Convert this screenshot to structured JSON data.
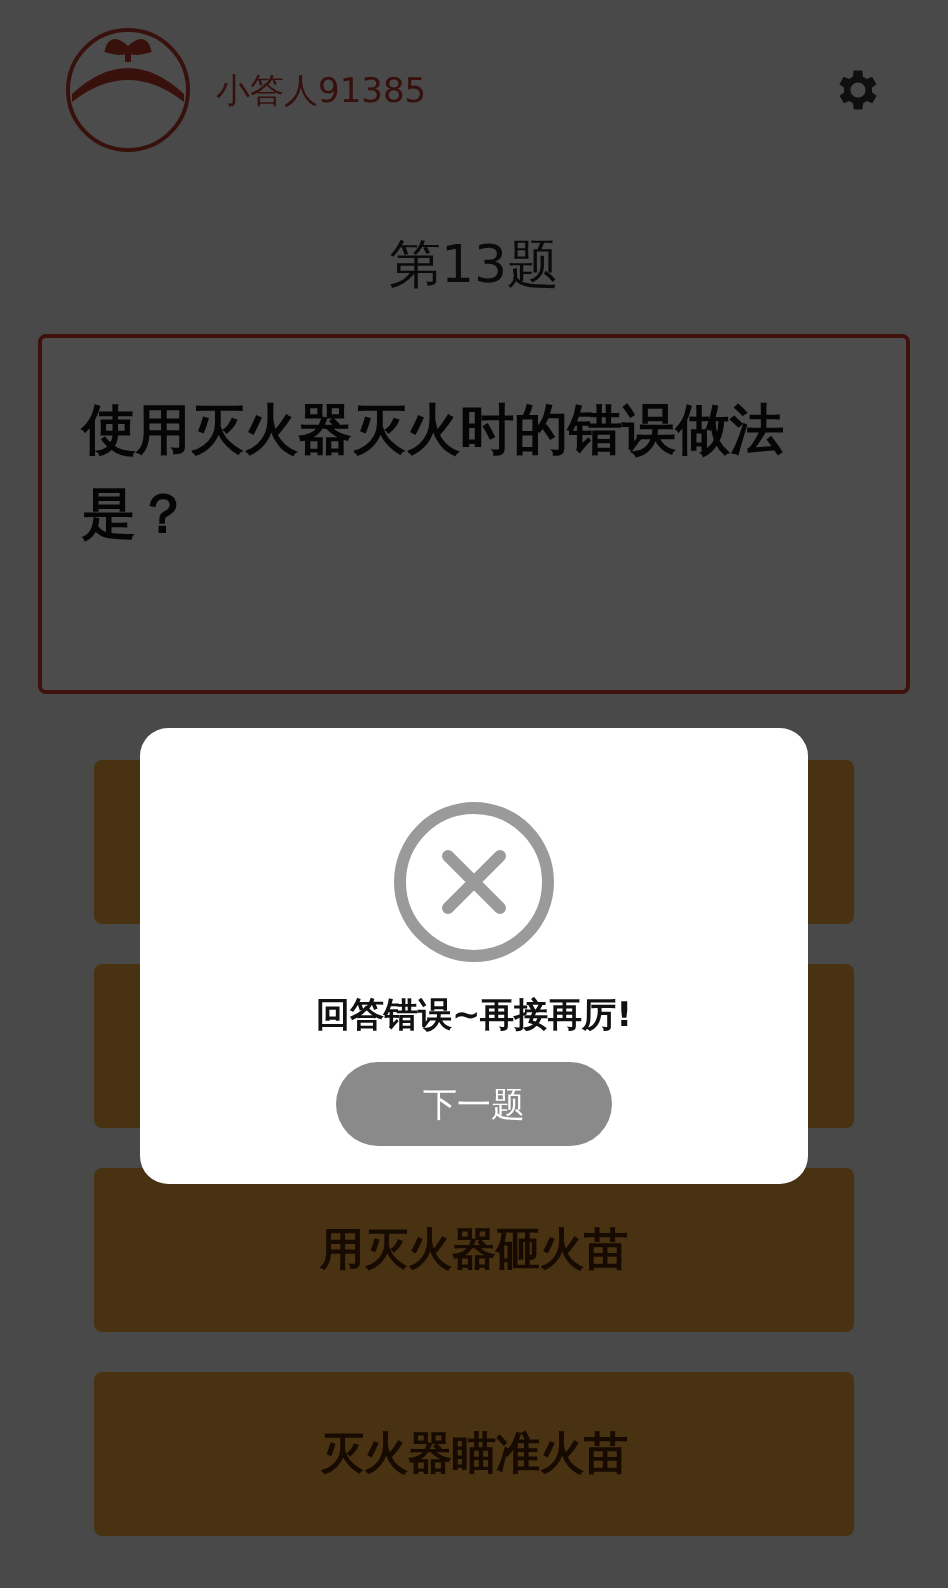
{
  "header": {
    "username": "小答人91385"
  },
  "question": {
    "number": "第13题",
    "text": "使用灭火器灭火时的错误做法是？"
  },
  "options": [
    {
      "kind": "covered"
    },
    {
      "kind": "covered"
    },
    {
      "kind": "answer",
      "label": "用灭火器砸火苗"
    },
    {
      "kind": "answer",
      "label": "灭火器瞄准火苗"
    }
  ],
  "dialog": {
    "message": "回答错误~再接再厉!",
    "button": "下一题"
  }
}
